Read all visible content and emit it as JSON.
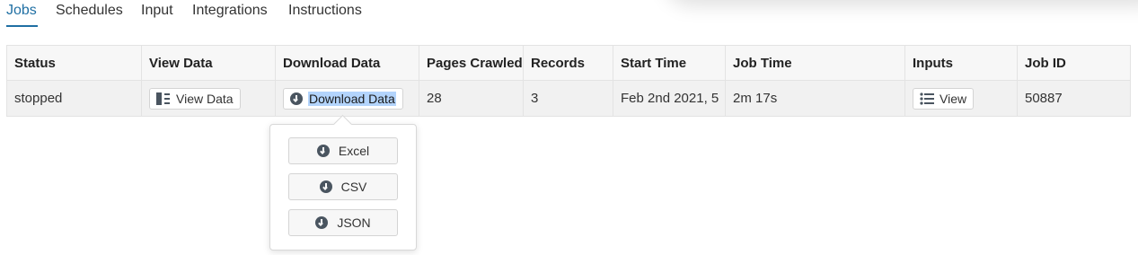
{
  "tabs": [
    "Jobs",
    "Schedules",
    "Input",
    "Integrations",
    "Instructions"
  ],
  "colors": {
    "accent": "#1f6fa3",
    "icon": "#4a5560",
    "selection": "#b3d4fc"
  },
  "table": {
    "headers": [
      "Status",
      "View Data",
      "Download Data",
      "Pages Crawled",
      "Records",
      "Start Time",
      "Job Time",
      "Inputs",
      "Job ID"
    ],
    "row": {
      "status": "stopped",
      "view_data_label": "View Data",
      "download_data_label": "Download Data",
      "pages_crawled": "28",
      "records": "3",
      "start_time": "Feb 2nd 2021, 5",
      "job_time": "2m 17s",
      "inputs_label": "View",
      "job_id": "50887"
    }
  },
  "download_menu": {
    "options": [
      "Excel",
      "CSV",
      "JSON"
    ]
  },
  "icons": {
    "view_data": "columns-icon",
    "download": "download-circle-icon",
    "inputs": "list-icon"
  }
}
